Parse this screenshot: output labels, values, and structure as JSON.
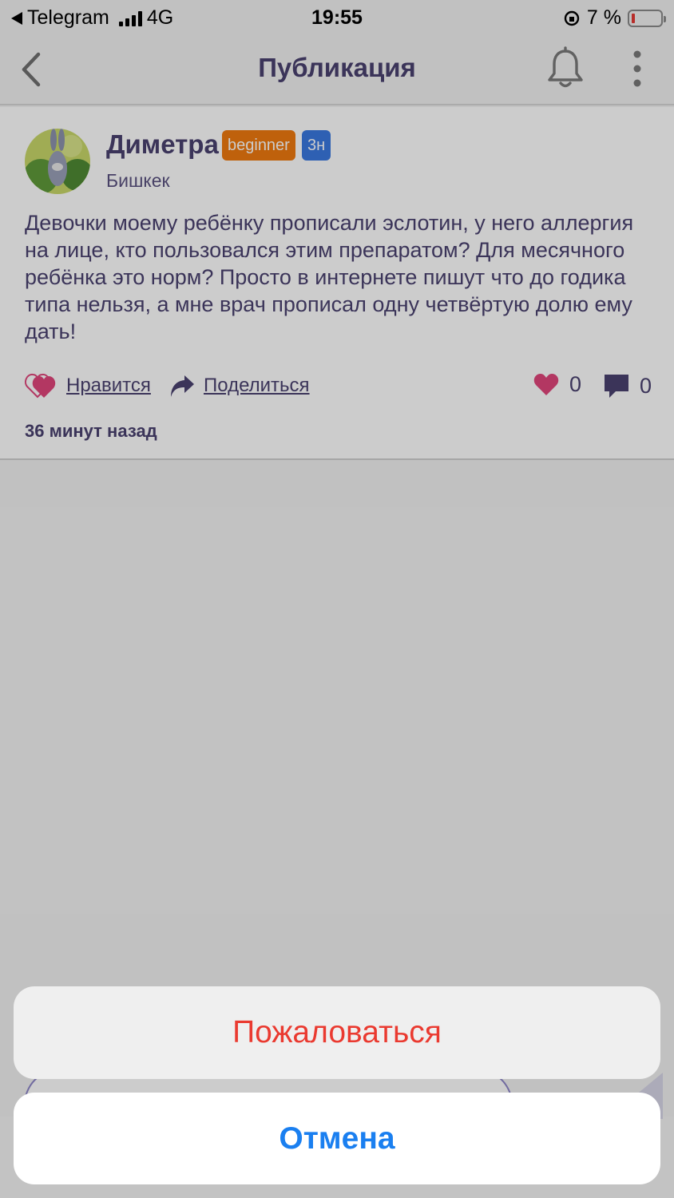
{
  "status_bar": {
    "back_app": "Telegram",
    "network": "4G",
    "time": "19:55",
    "battery_percent": "7 %",
    "battery_level": 0.07,
    "battery_color": "#e53935"
  },
  "nav": {
    "title": "Публикация",
    "back_icon": "chevron-left-icon",
    "bell_icon": "bell-icon",
    "more_icon": "more-vertical-icon"
  },
  "post": {
    "author": "Диметра",
    "level_badge": "beginner",
    "age_badge": "3н",
    "city": "Бишкек",
    "text": "Девочки моему ребёнку прописали эслотин, у него аллергия на лице, кто пользовался этим препаратом? Для месячного ребёнка это норм? Просто в интернете пишут что до годика типа нельзя, а мне врач прописал одну четвёртую долю ему дать!",
    "like_label": "Нравится",
    "share_label": "Поделиться",
    "likes_count": "0",
    "comments_count": "0",
    "time_ago": "36 минут назад"
  },
  "action_sheet": {
    "report_label": "Пожаловаться",
    "cancel_label": "Отмена"
  },
  "colors": {
    "accent": "#4a4270",
    "like_pink": "#e0457b",
    "badge_orange": "#ef7a10",
    "badge_blue": "#3a78e0",
    "report_red": "#ea3a30",
    "cancel_blue": "#1a7ff0"
  }
}
